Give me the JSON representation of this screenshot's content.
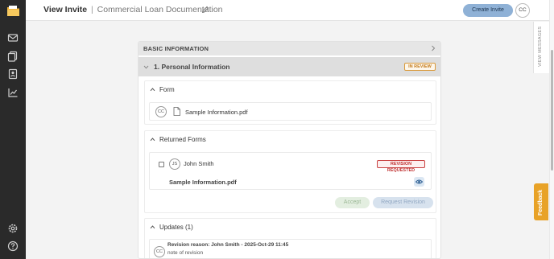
{
  "header": {
    "title": "View Invite",
    "separator": "|",
    "subtitle": "Commercial Loan Documentation",
    "create_button": "Create Invite",
    "user_initials": "CC"
  },
  "side_tabs": {
    "view_messages": "VIEW MESSAGES",
    "feedback": "Feedback"
  },
  "panel": {
    "title": "BASIC INFORMATION",
    "section": {
      "title": "1. Personal Information",
      "status": "IN REVIEW"
    },
    "form": {
      "title": "Form",
      "avatar": "CC",
      "file_name": "Sample Information.pdf"
    },
    "returned_forms": {
      "title": "Returned Forms",
      "avatar": "JS",
      "user_name": "John Smith",
      "status": "REVISION REQUESTED",
      "file_name": "Sample Information.pdf",
      "accept_button": "Accept",
      "request_revision_button": "Request Revision"
    },
    "updates": {
      "title": "Updates (1)",
      "avatar": "CC",
      "heading": "Revision reason: John Smith - 2025-Oct-29 11:45",
      "note": "note of revision"
    }
  },
  "colors": {
    "sidebar": "#2a2a2a",
    "accent": "#8fb1d6",
    "in_review": "#c47a1b",
    "revision_requested": "#c03333",
    "feedback": "#e8a227"
  }
}
